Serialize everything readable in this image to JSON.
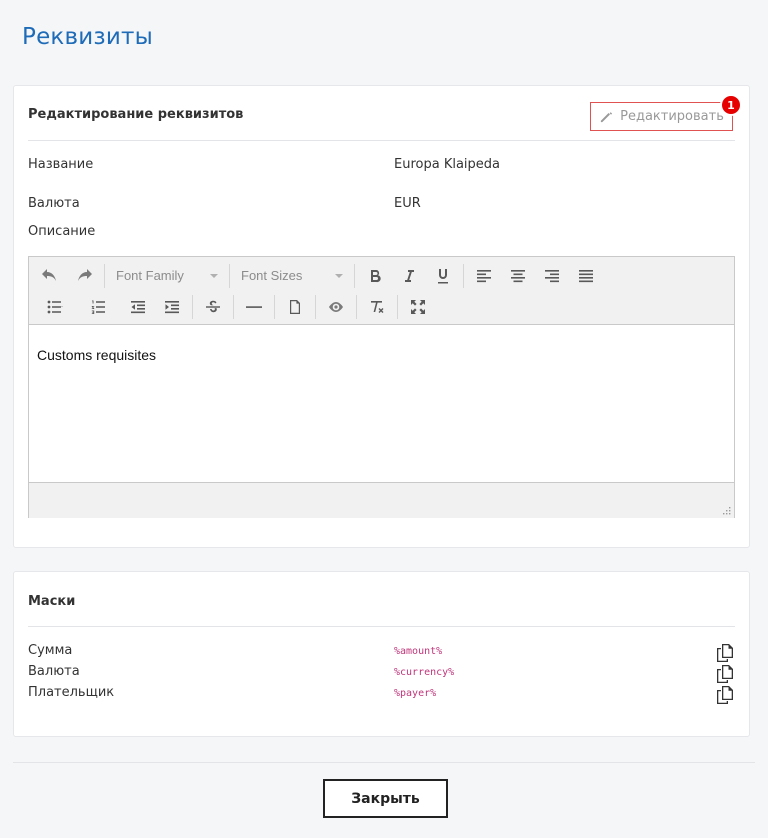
{
  "page": {
    "title": "Реквизиты"
  },
  "requisites": {
    "title": "Редактирование реквизитов",
    "edit_label": "Редактировать",
    "badge_count": "1",
    "fields": [
      {
        "label": "Название",
        "value": "Europa Klaipeda"
      },
      {
        "label": "Валюта",
        "value": "EUR"
      }
    ],
    "description_label": "Описание",
    "editor": {
      "font_family_placeholder": "Font Family",
      "font_sizes_placeholder": "Font Sizes",
      "content": "Customs requisites"
    }
  },
  "masks": {
    "title": "Маски",
    "items": [
      {
        "label": "Сумма",
        "code": "%amount%"
      },
      {
        "label": "Валюта",
        "code": "%currency%"
      },
      {
        "label": "Плательщик",
        "code": "%payer%"
      }
    ]
  },
  "footer": {
    "close_label": "Закрыть"
  },
  "colors": {
    "title": "#1e6bb8",
    "mask_code": "#c0357a",
    "badge": "#e60000"
  }
}
